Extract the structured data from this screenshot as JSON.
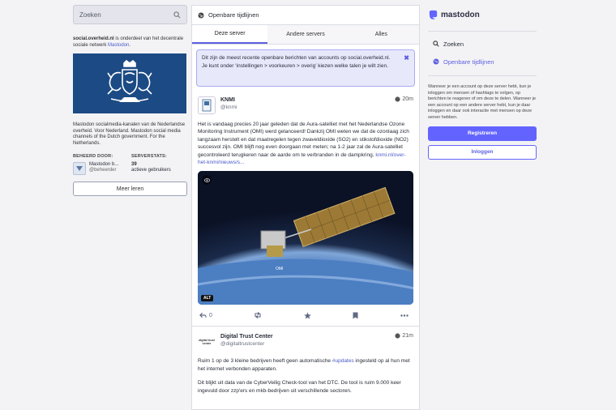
{
  "search": {
    "placeholder": "Zoeken"
  },
  "about": {
    "domain": "social.overheid.nl",
    "text_mid": " is onderdeel van het decentrale sociale netwerk ",
    "link": "Mastodon",
    "text_end": ".",
    "description": "Mastodon socialmedia-kanalen van de Nederlandse overheid. Voor Nederland. Mastodon social media channels of the Dutch government. For the Netherlands."
  },
  "stats": {
    "admin_label": "BEHEERD DOOR:",
    "stats_label": "SERVERSTATS:",
    "admin_name": "Mastodon b...",
    "admin_handle": "@beheerder",
    "active_count": "39",
    "active_label": "actieve gebruikers"
  },
  "more_button": "Meer leren",
  "timeline": {
    "title": "Openbare tijdlijnen",
    "tabs": [
      "Deze server",
      "Andere servers",
      "Alles"
    ],
    "notice": "Dit zijn de meest recente openbare berichten van accounts op social.overheid.nl. Je kunt onder ‘instellingen > voorkeuren > overig’ kiezen welke talen je wilt zien.",
    "notice_close": "✖"
  },
  "posts": [
    {
      "name": "KNMI",
      "handle": "@knmi",
      "time": "20m",
      "body": "Het is vandaag precies 20 jaar geleden dat de Aura-satelliet met het Nederlandse Ozone Monitoring Instrument (OMI) werd gelanceerd! Dankzij OMI weten we dat de ozonlaag zich langzaam herstelt en dat maatregelen tegen zwaveldioxide (SO2) en stikstofdioxide (NO2) succesvol zijn. OMI blijft nog even doorgaan met meten; na 1-2 jaar zal de Aura-satelliet gecontroleerd terugkeren naar de aarde om te verbranden in de dampkring. ",
      "link": "knmi.nl/over-het-knmi/nieuws/s...",
      "alt": "ALT",
      "reply_count": "0",
      "media_label": "OMI"
    },
    {
      "name": "Digital Trust Center",
      "handle": "@digitaltrustcenter",
      "time": "21m",
      "body_pre": "Ruim 1 op de 3 kleine bedrijven heeft geen automatische ",
      "hashtag": "#updates",
      "body_post": " ingesteld op al hun met het internet verbonden apparaten.",
      "body2": "Dit blijkt uit data van de CyberVeilig Check-tool van het DTC. De tool is ruim 9.000 keer ingevuld door zzp'ers en mkb-bedrijven uit verschillende sectoren.",
      "avatar_text": "digital trust center"
    }
  ],
  "right": {
    "brand": "mastodon",
    "nav": [
      "Zoeken",
      "Openbare tijdlijnen"
    ],
    "signup_text": "Wanneer je een account op deze server hebt, kun je inloggen om mensen of hashtags te volgen, op berichten te reageren of om deze te delen. Wanneer je een account op een andere server hebt, kun je daar inloggen en daar ook interactie met mensen op deze server hebben.",
    "register": "Registreren",
    "login": "Inloggen"
  },
  "colors": {
    "accent": "#6364ff",
    "banner": "#1c4a84"
  }
}
